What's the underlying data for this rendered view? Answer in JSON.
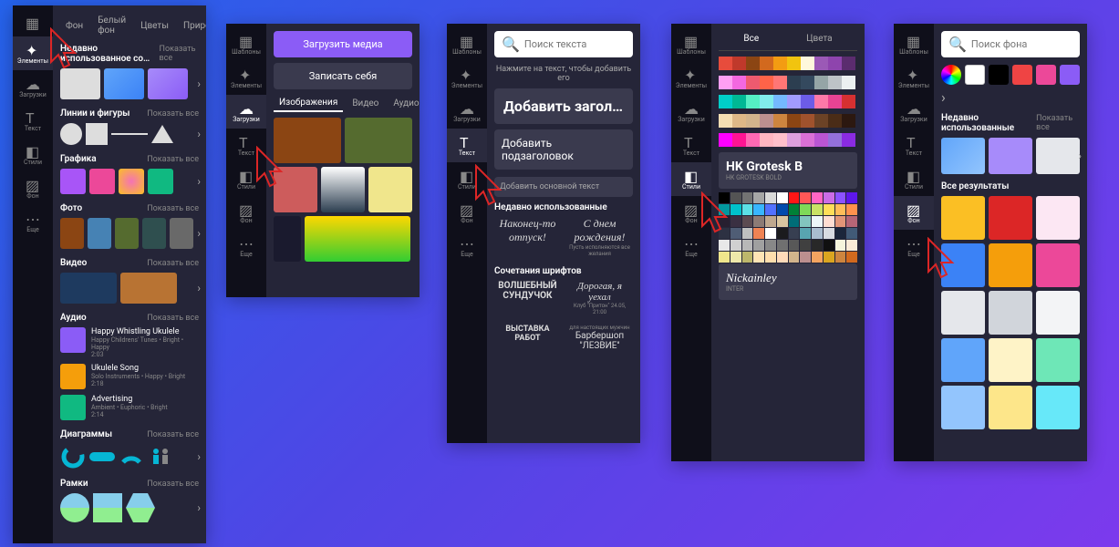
{
  "sidebar": {
    "templates": "Шаблоны",
    "elements": "Элементы",
    "uploads": "Загрузки",
    "text": "Текст",
    "styles": "Стили",
    "background": "Фон",
    "more": "Еще"
  },
  "p1": {
    "tabs": [
      "Фон",
      "Белый фон",
      "Цветы",
      "Природа"
    ],
    "recent": {
      "title": "Недавно использованное со…",
      "more": "Показать все"
    },
    "lines": {
      "title": "Линии и фигуры",
      "more": "Показать все"
    },
    "graphics": {
      "title": "Графика",
      "more": "Показать все"
    },
    "photo": {
      "title": "Фото",
      "more": "Показать все"
    },
    "video": {
      "title": "Видео",
      "more": "Показать все"
    },
    "audio": {
      "title": "Аудио",
      "more": "Показать все",
      "items": [
        {
          "title": "Happy Whistling Ukulele",
          "meta": "Happy Childrens' Tunes • Bright • Happy",
          "dur": "2:03"
        },
        {
          "title": "Ukulele Song",
          "meta": "Solo Instruments • Happy • Bright",
          "dur": "2:18"
        },
        {
          "title": "Advertising",
          "meta": "Ambient • Euphoric • Bright",
          "dur": "2:14"
        }
      ]
    },
    "charts": {
      "title": "Диаграммы",
      "more": "Показать все"
    },
    "frames": {
      "title": "Рамки",
      "more": "Показать все"
    }
  },
  "p2": {
    "upload": "Загрузить медиа",
    "record": "Записать себя",
    "tabs": [
      "Изображения",
      "Видео",
      "Аудио"
    ]
  },
  "p3": {
    "placeholder": "Поиск текста",
    "hint": "Нажмите на текст, чтобы добавить его",
    "h1": "Добавить загол…",
    "h2": "Добавить подзаголовок",
    "h3": "Добавить основной текст",
    "recent": "Недавно использованные",
    "pair1a": "Наконец-то отпуск!",
    "pair1b": "С днем рождения!",
    "pair1bm": "Пусть исполняются все желания",
    "combos": "Сочетания шрифтов",
    "pair2a": "ВОЛШЕБНЫЙ СУНДУЧОК",
    "pair2b": "Дорогая, я уехал",
    "pair2bm": "Клуб \"Притон\" 24.05, 21:00",
    "pair3a": "ВЫСТАВКА РАБОТ",
    "pair3b": "Барбершоп \"ЛЕЗВИЕ\"",
    "pair3bm": "для настоящих мужчин"
  },
  "p4": {
    "tabs": [
      "Все",
      "Цвета"
    ],
    "font": "HK Grotesk B",
    "fontSub": "HK GROTESK BOLD",
    "nick": "Nickainley",
    "nickSub": "INTER"
  },
  "p5": {
    "placeholder": "Поиск фона",
    "recent": "Недавно использованные",
    "more": "Показать все",
    "results": "Все результаты"
  },
  "palettes": [
    [
      "#e74c3c",
      "#c0392b",
      "#8b4513",
      "#d2691e",
      "#f39c12",
      "#f1c40f",
      "#fff8dc",
      "#9b59b6",
      "#8e44ad",
      "#5b2c6f"
    ],
    [
      "#ff9ff3",
      "#f368e0",
      "#ee5a6f",
      "#ff6348",
      "#ff7675",
      "#2c3e50",
      "#34495e",
      "#95a5a6",
      "#bdc3c7",
      "#ecf0f1"
    ],
    [
      "#00cec9",
      "#00b894",
      "#55efc4",
      "#81ecec",
      "#74b9ff",
      "#a29bfe",
      "#6c5ce7",
      "#fd79a8",
      "#e84393",
      "#d63031"
    ],
    [
      "#f5deb3",
      "#deb887",
      "#d2b48c",
      "#bc8f8f",
      "#cd853f",
      "#8b4513",
      "#a0522d",
      "#6b4226",
      "#4a2c17",
      "#2c1810"
    ],
    [
      "#ff00ff",
      "#ff1493",
      "#ff69b4",
      "#ffb6c1",
      "#ffc0cb",
      "#dda0dd",
      "#da70d6",
      "#ba55d3",
      "#9370db",
      "#8a2be2"
    ]
  ],
  "bigPalette": [
    [
      "#000",
      "#545454",
      "#737373",
      "#a6a6a6",
      "#d9d9d9",
      "#fff",
      "#ff1616",
      "#ff5757",
      "#ff66c4",
      "#cb6ce6",
      "#8c52ff",
      "#5e17eb"
    ],
    [
      "#03989e",
      "#00c2cb",
      "#5ce1e6",
      "#38b6ff",
      "#5271ff",
      "#004aad",
      "#008037",
      "#7ed957",
      "#c9e265",
      "#ffde59",
      "#ffbd59",
      "#ff914d"
    ],
    [
      "#271f30",
      "#3a3042",
      "#5c4b51",
      "#8c7b75",
      "#bfa88f",
      "#d9c5a0",
      "#006d77",
      "#83c5be",
      "#edf6f9",
      "#ffddd2",
      "#e29578",
      "#b56576"
    ],
    [
      "#2d3142",
      "#4f5d75",
      "#bfc0c0",
      "#ef8354",
      "#fff",
      "#1b1b1e",
      "#373f51",
      "#58a4b0",
      "#a9bcd0",
      "#d8dbe2",
      "#1b263b",
      "#415a77"
    ],
    [
      "#e8e8e8",
      "#d0d0d0",
      "#b8b8b8",
      "#a0a0a0",
      "#888",
      "#707070",
      "#585858",
      "#404040",
      "#282828",
      "#101010",
      "#f5f5dc",
      "#faebd7"
    ],
    [
      "#f0e68c",
      "#eee8aa",
      "#bdb76b",
      "#ffe4b5",
      "#ffdead",
      "#ffdab9",
      "#d2b48c",
      "#bc8f8f",
      "#f4a460",
      "#daa520",
      "#cd853f",
      "#d2691e"
    ]
  ]
}
